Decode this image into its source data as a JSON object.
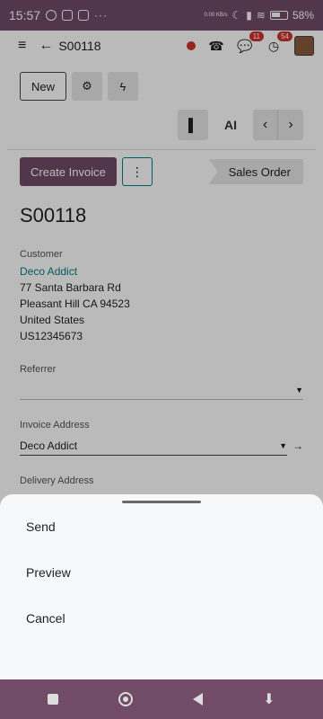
{
  "status_bar": {
    "time": "15:57",
    "net_speed": "0.00 KB/s",
    "battery": "58%"
  },
  "topbar": {
    "title": "S00118",
    "messages_badge": "11",
    "activities_badge": "54"
  },
  "toolbar": {
    "new_label": "New"
  },
  "actions": {
    "create_invoice": "Create Invoice",
    "stage": "Sales Order",
    "ai_label": "AI"
  },
  "record": {
    "title": "S00118",
    "customer_label": "Customer",
    "customer_name": "Deco Addict",
    "address_lines": [
      "77 Santa Barbara Rd",
      "Pleasant Hill CA 94523",
      "United States",
      "US12345673"
    ],
    "referrer_label": "Referrer",
    "invoice_address_label": "Invoice Address",
    "invoice_address_value": "Deco Addict",
    "delivery_address_label": "Delivery Address"
  },
  "sheet": {
    "items": [
      "Send",
      "Preview",
      "Cancel"
    ]
  },
  "colors": {
    "brand": "#714b67",
    "accent": "#017e84",
    "badge": "#d0332b"
  },
  "icons": [
    "whatsapp-icon",
    "gallery-icon",
    "wifi-icon",
    "signal-icon",
    "moon-icon",
    "battery-icon",
    "phone-icon",
    "chat-icon",
    "clock-icon",
    "gear-icon",
    "bolt-icon",
    "bookmark-icon",
    "chevron-left-icon",
    "chevron-right-icon"
  ]
}
